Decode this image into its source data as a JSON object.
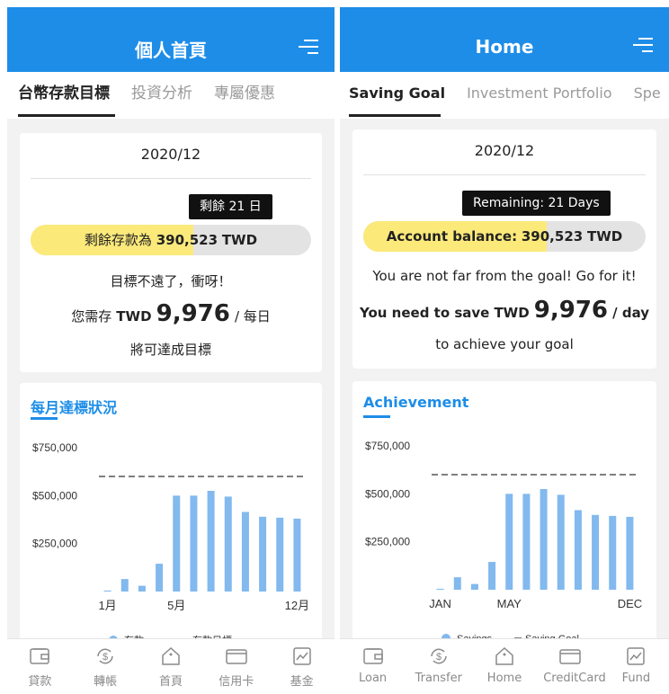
{
  "colors": {
    "brand": "#1d8de8",
    "progress_fill": "#fbe97a",
    "bar": "#82b9ee"
  },
  "screens": [
    {
      "header": {
        "title": "個人首頁"
      },
      "tabs": [
        {
          "label": "台幣存款目標"
        },
        {
          "label": "投資分析"
        },
        {
          "label": "專屬優惠"
        }
      ],
      "goal": {
        "date": "2020/12",
        "tooltip": "剩餘 21 日",
        "progress_label": "剩餘存款為",
        "progress_amount": "390,523",
        "progress_unit": "TWD",
        "progress_fraction": 0.58,
        "message": "目標不遠了，衝呀！",
        "save_prefix": "您需存",
        "save_currency": "TWD",
        "save_amount": "9,976",
        "save_suffix": "/ 每日",
        "closing": "將可達成目標"
      },
      "chart_title": "每月達標狀況",
      "nav": [
        {
          "label": "貸款",
          "icon": "wallet-icon"
        },
        {
          "label": "轉帳",
          "icon": "transfer-icon"
        },
        {
          "label": "首頁",
          "icon": "home-icon"
        },
        {
          "label": "信用卡",
          "icon": "credit-card-icon"
        },
        {
          "label": "基金",
          "icon": "fund-chart-icon"
        }
      ]
    },
    {
      "header": {
        "title": "Home"
      },
      "tabs": [
        {
          "label": "Saving Goal"
        },
        {
          "label": "Investment Portfolio"
        },
        {
          "label": "Spe"
        }
      ],
      "goal": {
        "date": "2020/12",
        "tooltip": "Remaining: 21 Days",
        "progress_label": "Account balance:",
        "progress_amount": "390,523",
        "progress_unit": "TWD",
        "progress_fraction": 0.65,
        "message": "You are not far from the goal! Go for it!",
        "save_prefix": "You need to save",
        "save_currency": "TWD",
        "save_amount": "9,976",
        "save_suffix": "/ day",
        "closing": "to achieve your goal"
      },
      "chart_title": "Achievement",
      "nav": [
        {
          "label": "Loan",
          "icon": "wallet-icon"
        },
        {
          "label": "Transfer",
          "icon": "transfer-icon"
        },
        {
          "label": "Home",
          "icon": "home-icon"
        },
        {
          "label": "CreditCard",
          "icon": "credit-card-icon"
        },
        {
          "label": "Fund",
          "icon": "fund-chart-icon"
        }
      ]
    }
  ],
  "chart_data": [
    {
      "type": "bar",
      "title": "每月達標狀況",
      "categories": [
        "1月",
        "",
        "",
        "",
        "5月",
        "",
        "",
        "",
        "",
        "",
        "",
        "12月"
      ],
      "series": [
        {
          "name": "存款",
          "values": [
            5000,
            65000,
            30000,
            145000,
            500000,
            500000,
            525000,
            495000,
            415000,
            390000,
            385000,
            380000
          ]
        }
      ],
      "goal_line": {
        "name": "存款目標",
        "value": 600000
      },
      "yticks": [
        "$750,000",
        "$500,000",
        "$250,000"
      ],
      "ylim": [
        0,
        750000
      ],
      "legend": "bottom"
    },
    {
      "type": "bar",
      "title": "Achievement",
      "categories": [
        "JAN",
        "",
        "",
        "",
        "MAY",
        "",
        "",
        "",
        "",
        "",
        "",
        "DEC"
      ],
      "series": [
        {
          "name": "Savings",
          "values": [
            5000,
            65000,
            30000,
            145000,
            500000,
            500000,
            525000,
            495000,
            415000,
            390000,
            385000,
            380000
          ]
        }
      ],
      "goal_line": {
        "name": "Saving Goal",
        "value": 600000
      },
      "yticks": [
        "$750,000",
        "$500,000",
        "$250,000"
      ],
      "ylim": [
        0,
        750000
      ],
      "legend": "bottom"
    }
  ]
}
